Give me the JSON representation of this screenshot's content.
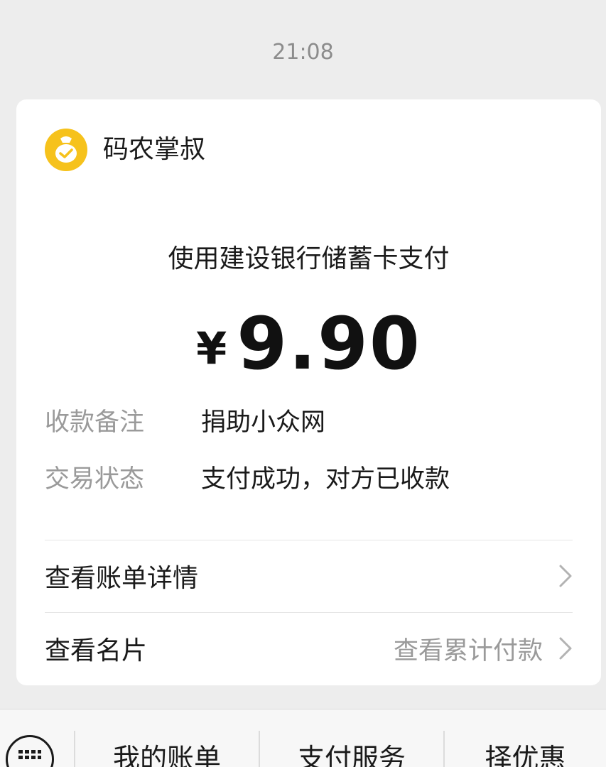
{
  "timestamp": "21:08",
  "merchant": {
    "name": "码农掌叔",
    "logo_icon": "money-bag-check-icon",
    "logo_color": "#f6c21c"
  },
  "payment": {
    "method": "使用建设银行储蓄卡支付",
    "currency": "¥",
    "amount": "9.90"
  },
  "details": [
    {
      "label": "收款备注",
      "value": "捐助小众网"
    },
    {
      "label": "交易状态",
      "value": "支付成功，对方已收款"
    }
  ],
  "links": {
    "bill_details": "查看账单详情",
    "card": "查看名片",
    "cumulative": "查看累计付款"
  },
  "bottom_bar": {
    "keyboard_icon": "keyboard-icon",
    "items": [
      "我的账单",
      "支付服务",
      "择优惠"
    ]
  }
}
